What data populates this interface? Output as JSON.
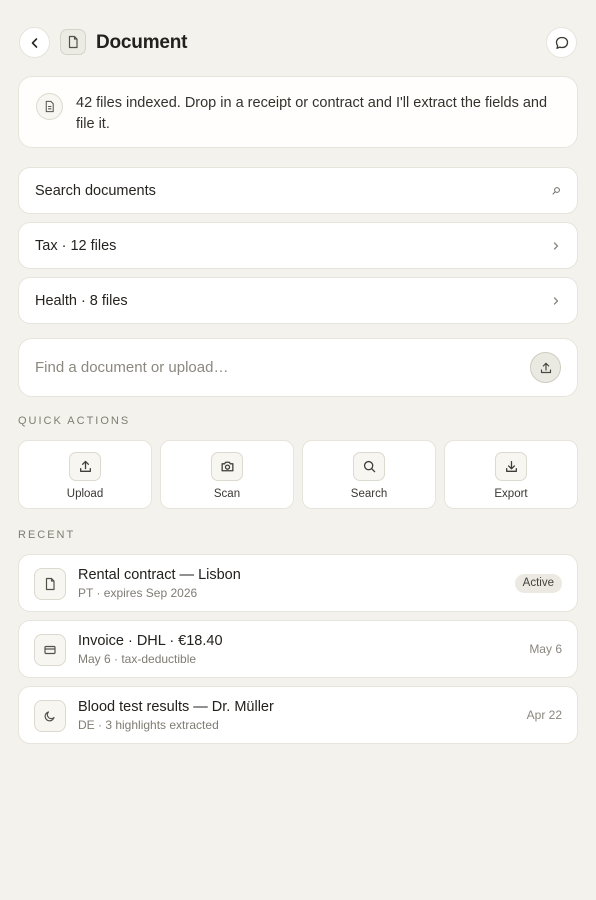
{
  "header": {
    "title": "Document",
    "back_icon": "chevron-left-icon",
    "doc_icon": "file-icon",
    "chat_icon": "chat-bubble-icon"
  },
  "banner": {
    "icon": "file-text-icon",
    "text": "42 files indexed. Drop in a receipt or contract and I'll extract the fields and file it."
  },
  "rows": [
    {
      "label": "Search documents",
      "trail_icon": "search-small-icon"
    },
    {
      "label": "Tax · 12 files",
      "trail": "›"
    },
    {
      "label": "Health · 8 files",
      "trail": "›"
    }
  ],
  "upload": {
    "placeholder": "Find a document or upload…",
    "icon": "upload-icon"
  },
  "quick_actions": {
    "title": "QUICK ACTIONS",
    "items": [
      {
        "label": "Upload",
        "icon": "upload-icon"
      },
      {
        "label": "Scan",
        "icon": "camera-icon"
      },
      {
        "label": "Search",
        "icon": "search-icon"
      },
      {
        "label": "Export",
        "icon": "download-icon"
      }
    ]
  },
  "recent": {
    "title": "RECENT",
    "items": [
      {
        "title": "Rental contract — Lisbon",
        "subtitle": "PT · expires Sep 2026",
        "badge": "Active",
        "icon": "file-icon"
      },
      {
        "title": "Invoice · DHL · €18.40",
        "subtitle": "May 6 · tax-deductible",
        "date": "May 6",
        "icon": "credit-card-icon"
      },
      {
        "title": "Blood test results — Dr. Müller",
        "subtitle": "DE · 3 highlights extracted",
        "date": "Apr 22",
        "icon": "moon-icon"
      }
    ]
  },
  "colors": {
    "background": "#f4f2ec",
    "card": "#ffffff",
    "border": "#e7e4dc",
    "text": "#23211d",
    "muted": "#7f7c73"
  }
}
